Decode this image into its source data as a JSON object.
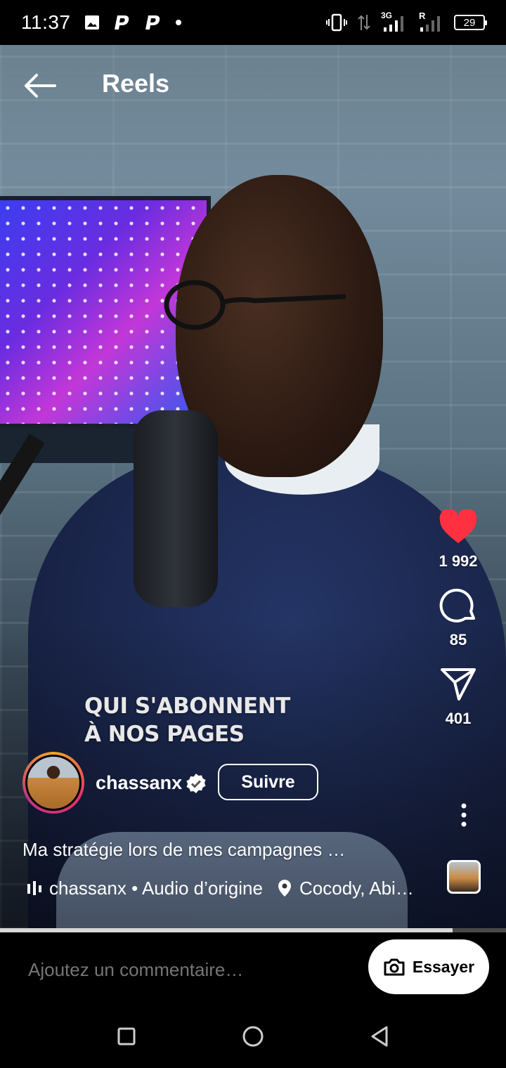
{
  "status_bar": {
    "time": "11:37",
    "network": "3G",
    "roaming": "R",
    "battery": "29",
    "icons": [
      "image-icon",
      "paypal-icon",
      "paypal-icon",
      "dot-icon",
      "vibrate-icon",
      "data-arrows-icon",
      "signal-icon",
      "signal-icon",
      "battery-icon"
    ]
  },
  "header": {
    "title": "Reels",
    "back_icon": "arrow-left-icon"
  },
  "video": {
    "overlay_line1": "QUI S'ABONNENT",
    "overlay_line2": "À NOS PAGES",
    "progress_fraction": 0.895
  },
  "actions": {
    "likes": "1 992",
    "comments": "85",
    "shares": "401",
    "like_color": "#ff3040"
  },
  "author": {
    "username": "chassanx",
    "verified": true,
    "follow_label": "Suivre"
  },
  "caption": "Ma stratégie lors de mes campagnes …",
  "audio": {
    "text": "chassanx • Audio d’origine",
    "location": "Cocody, Abidjan"
  },
  "comment_bar": {
    "placeholder": "Ajoutez un commentaire…",
    "try_label": "Essayer"
  },
  "nav": {
    "icons": [
      "recents-icon",
      "home-icon",
      "back-icon"
    ]
  }
}
